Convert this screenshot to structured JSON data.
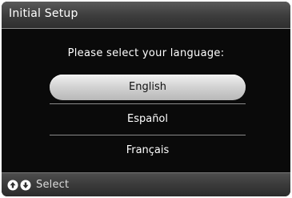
{
  "header": {
    "title": "Initial Setup"
  },
  "main": {
    "prompt": "Please select your language:",
    "languages": [
      {
        "label": "English",
        "selected": true
      },
      {
        "label": "Español",
        "selected": false
      },
      {
        "label": "Français",
        "selected": false
      }
    ]
  },
  "footer": {
    "icons": [
      "up-arrow-button-icon",
      "down-arrow-button-icon"
    ],
    "label": "Select"
  },
  "colors": {
    "background": "#0a0a0a",
    "bar": "#3e3e3e",
    "selected_pill": "#d4d4d4",
    "text": "#ffffff"
  }
}
